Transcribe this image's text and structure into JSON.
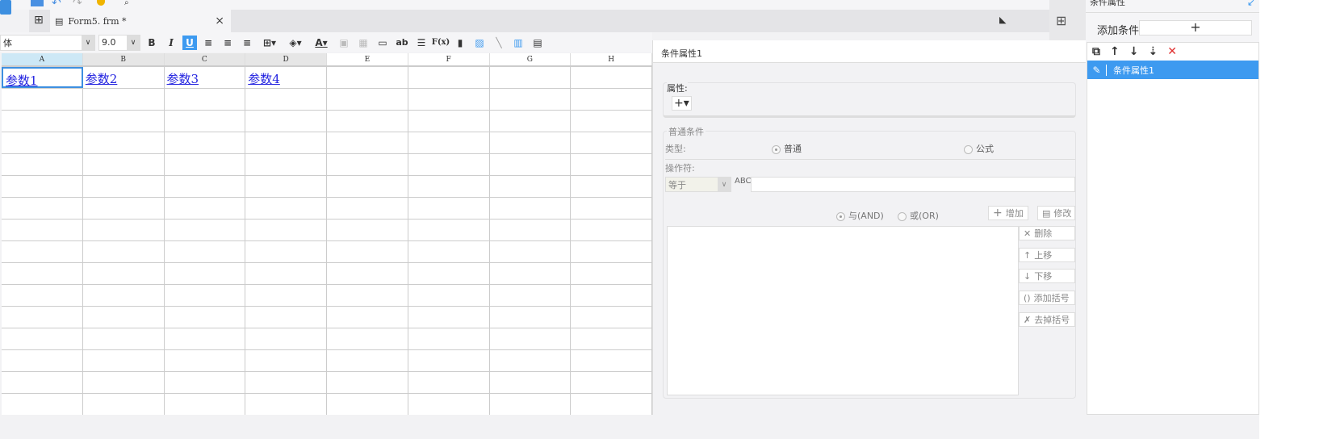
{
  "tab": {
    "title": "Form5. frm *",
    "close": "×"
  },
  "format": {
    "font": "体",
    "size": "9.0",
    "bold": "B",
    "italic": "I",
    "underline": "U",
    "text": "ab",
    "formula": "F(x)"
  },
  "grid": {
    "columns": [
      "A",
      "B",
      "C",
      "D",
      "E",
      "F",
      "G",
      "H"
    ],
    "row1": [
      "参数1",
      "参数2",
      "参数3",
      "参数4",
      "",
      "",
      "",
      ""
    ],
    "row_count": 16
  },
  "dialog": {
    "title": "条件属性1",
    "attr_label": "属性:",
    "add": "+▾",
    "group": "普通条件",
    "type_label": "类型:",
    "type_normal": "普通",
    "type_formula": "公式",
    "operator_label": "操作符:",
    "operator_value": "等于",
    "and_label": "与(AND)",
    "or_label": "或(OR)",
    "buttons": {
      "add": "增加",
      "modify": "修改",
      "delete": "删除",
      "up": "上移",
      "down": "下移",
      "add_bracket": "添加括号",
      "remove_bracket": "去掉括号"
    }
  },
  "right_panel": {
    "title": "条件属性",
    "add_condition": "添加条件",
    "add_btn": "+",
    "items": [
      "条件属性1"
    ]
  },
  "colors": {
    "accent": "#3d9af0",
    "link": "#2323e0"
  }
}
